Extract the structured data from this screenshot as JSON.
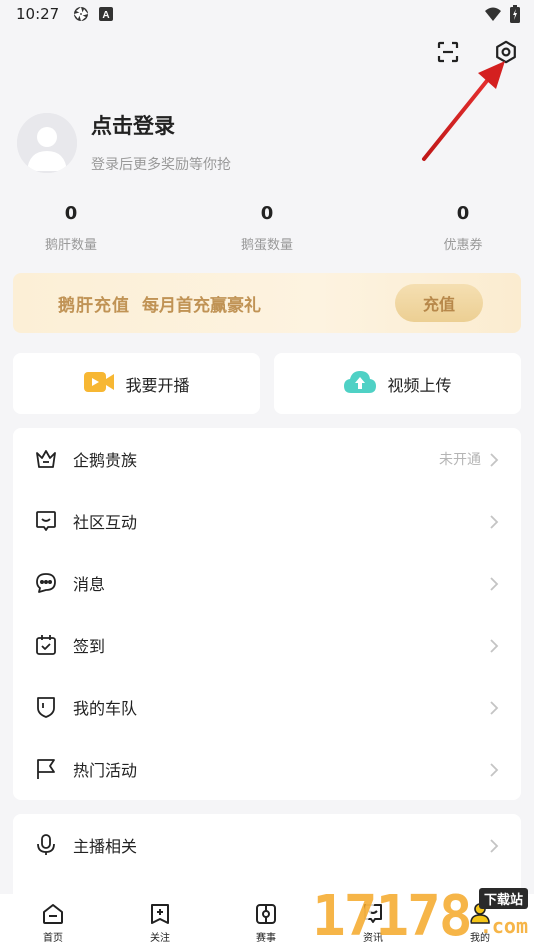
{
  "status_bar": {
    "time": "10:27"
  },
  "top_actions": {
    "scan": "scan-icon",
    "settings": "settings-icon"
  },
  "profile": {
    "title": "点击登录",
    "subtitle": "登录后更多奖励等你抢"
  },
  "stats": [
    {
      "value": "0",
      "label": "鹅肝数量"
    },
    {
      "value": "0",
      "label": "鹅蛋数量"
    },
    {
      "value": "0",
      "label": "优惠券"
    }
  ],
  "vip_banner": {
    "title": "鹅肝充值",
    "subtitle": "每月首充赢豪礼",
    "button": "充值"
  },
  "quick_actions": {
    "live": "我要开播",
    "upload": "视频上传"
  },
  "menu": [
    {
      "label": "企鹅贵族",
      "status": "未开通",
      "icon": "crown-icon"
    },
    {
      "label": "社区互动",
      "status": "",
      "icon": "community-icon"
    },
    {
      "label": "消息",
      "status": "",
      "icon": "message-icon"
    },
    {
      "label": "签到",
      "status": "",
      "icon": "calendar-check-icon"
    },
    {
      "label": "我的车队",
      "status": "",
      "icon": "shield-icon"
    },
    {
      "label": "热门活动",
      "status": "",
      "icon": "flag-icon"
    }
  ],
  "menu2": [
    {
      "label": "主播相关",
      "icon": "microphone-icon"
    }
  ],
  "bottom_nav": [
    {
      "label": "首页",
      "icon": "home-icon"
    },
    {
      "label": "关注",
      "icon": "follow-icon"
    },
    {
      "label": "赛事",
      "icon": "match-icon"
    },
    {
      "label": "资讯",
      "icon": "news-icon"
    },
    {
      "label": "我的",
      "icon": "profile-icon"
    }
  ],
  "watermark": {
    "digits": "17178",
    "tag": "下载站",
    "suffix": ".com"
  },
  "colors": {
    "accent_gold": "#c09355",
    "annotation_arrow": "#d42020"
  }
}
